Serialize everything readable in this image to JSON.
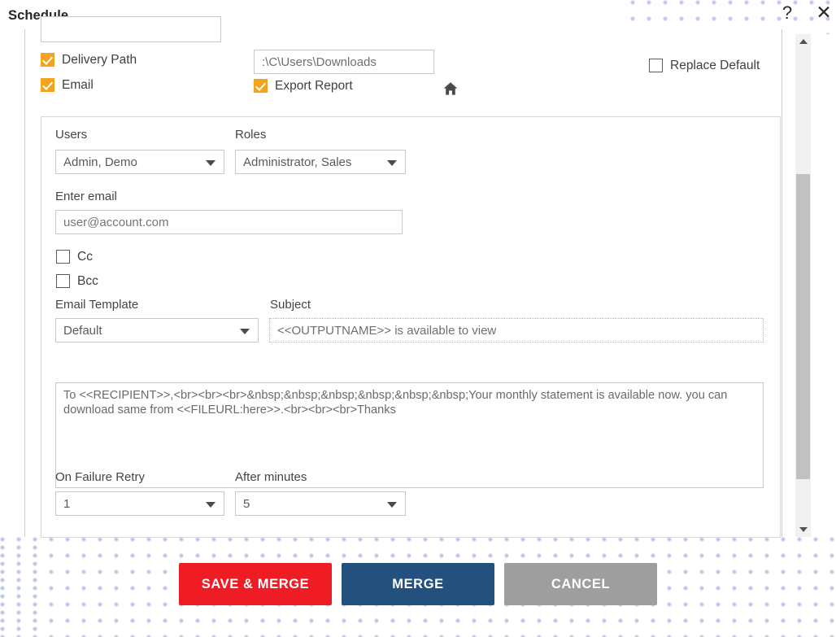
{
  "window": {
    "title": "Schedule",
    "help_icon": "question-mark-icon",
    "close_icon": "close-x-icon",
    "help_glyph": "?",
    "close_glyph": "✕"
  },
  "delivery": {
    "delivery_path_label": "Delivery Path",
    "delivery_path_checked": true,
    "email_label": "Email",
    "email_checked": true,
    "path_value": ":\\C\\Users\\Downloads",
    "home_icon": "home-icon",
    "export_report_label": "Export Report",
    "export_report_checked": true,
    "replace_default_label": "Replace Default",
    "replace_default_checked": false
  },
  "recipients": {
    "users_label": "Users",
    "users_value": "Admin, Demo",
    "roles_label": "Roles",
    "roles_value": "Administrator, Sales",
    "enter_email_label": "Enter email",
    "email_placeholder": "user@account.com",
    "cc_label": "Cc",
    "cc_checked": false,
    "bcc_label": "Bcc",
    "bcc_checked": false
  },
  "message": {
    "template_label": "Email Template",
    "template_value": "Default",
    "subject_label": "Subject",
    "subject_value": "<<OUTPUTNAME>> is available to view",
    "body_value": "To <<RECIPIENT>>,<br><br><br>&nbsp;&nbsp;&nbsp;&nbsp;&nbsp;&nbsp;Your monthly statement is available now. you can download same from <<FILEURL:here>>.<br><br><br>Thanks"
  },
  "retry": {
    "on_failure_retry_label": "On Failure Retry",
    "on_failure_retry_value": "1",
    "after_minutes_label": "After minutes",
    "after_minutes_value": "5"
  },
  "footer": {
    "save_merge_label": "SAVE & MERGE",
    "merge_label": "MERGE",
    "cancel_label": "CANCEL"
  },
  "scrollbar": {
    "up_arrow_icon": "chevron-up-icon",
    "down_arrow_icon": "chevron-down-icon"
  },
  "colors": {
    "checkbox_accent": "#f5a21e",
    "save_merge_bg": "#ef1c25",
    "merge_bg": "#23507d",
    "cancel_bg": "#9e9e9e",
    "dot_pattern": "#b9c0e8"
  }
}
